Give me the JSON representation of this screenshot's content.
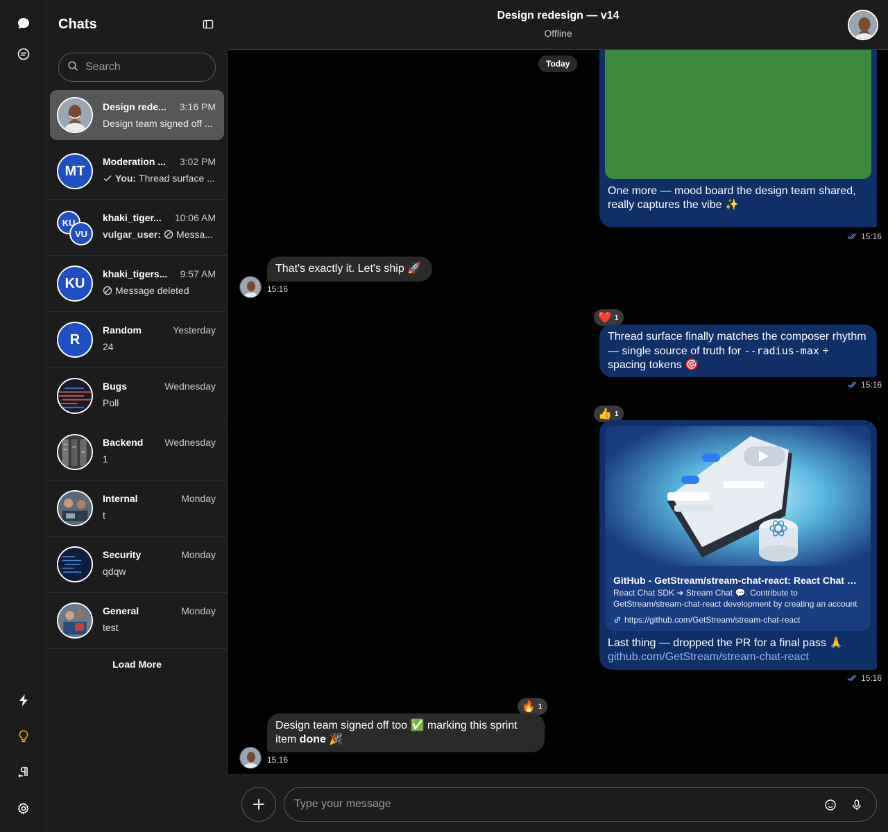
{
  "app": {
    "accent_color": "#0f2f66",
    "link_color": "#8fb4ff"
  },
  "rail": {
    "top_icons": [
      "chat-bubble-icon",
      "threads-icon"
    ],
    "bottom_icons": [
      "bolt-icon",
      "lightbulb-icon",
      "text-direction-icon",
      "gear-icon"
    ],
    "highlight_color": "#f0b400"
  },
  "channel_list": {
    "title": "Chats",
    "search_placeholder": "Search",
    "load_more": "Load More",
    "channels": [
      {
        "name": "Design rede...",
        "time": "3:16 PM",
        "preview": "Design team signed off ...",
        "avatar_type": "photo",
        "active": true
      },
      {
        "name": "Moderation ...",
        "time": "3:02 PM",
        "preview_prefix": "You:",
        "preview": "Thread surface ...",
        "avatar_initials": "MT",
        "status_icon": "check-icon"
      },
      {
        "name": "khaki_tiger...",
        "time": "10:06 AM",
        "preview_prefix": "vulgar_user:",
        "preview": "Messa...",
        "avatar_initials": "KU",
        "avatar_initials_2": "VU",
        "status_icon": "deleted-icon"
      },
      {
        "name": "khaki_tigers...",
        "time": "9:57 AM",
        "preview": "Message deleted",
        "avatar_initials": "KU",
        "status_icon": "deleted-icon"
      },
      {
        "name": "Random",
        "time": "Yesterday",
        "preview": "24",
        "avatar_initials": "R"
      },
      {
        "name": "Bugs",
        "time": "Wednesday",
        "preview": "Poll",
        "avatar_type": "photo"
      },
      {
        "name": "Backend",
        "time": "Wednesday",
        "preview": "1",
        "avatar_type": "photo"
      },
      {
        "name": "Internal",
        "time": "Monday",
        "preview": "t",
        "avatar_type": "photo"
      },
      {
        "name": "Security",
        "time": "Monday",
        "preview": "qdqw",
        "avatar_type": "photo"
      },
      {
        "name": "General",
        "time": "Monday",
        "preview": "test",
        "avatar_type": "photo"
      }
    ]
  },
  "header": {
    "title": "Design redesign — v14",
    "subtitle": "Offline"
  },
  "messages": {
    "date_separator": "Today",
    "items": [
      {
        "direction": "out",
        "text": "One more — mood board the design team shared, really captures the vibe ✨",
        "time": "15:16",
        "attachment_color": "#3d8a3f"
      },
      {
        "direction": "in",
        "text": "That's exactly it. Let's ship 🚀",
        "time": "15:16"
      },
      {
        "direction": "out",
        "text_1": "Thread surface finally matches the composer rhythm — single source of truth for ",
        "code": "--radius-max",
        "text_2": " + spacing tokens 🎯",
        "time": "15:16",
        "reaction": {
          "emoji": "❤️",
          "count": "1"
        }
      },
      {
        "direction": "out",
        "text": "Last thing — dropped the PR for a final pass 🙏",
        "link": "github.com/GetStream/stream-chat-react",
        "time": "15:16",
        "reaction": {
          "emoji": "👍",
          "count": "1"
        },
        "link_preview": {
          "title": "GitHub - GetStream/stream-chat-react: React Chat SDK ➜ Stream Chat 💬",
          "description": "React Chat SDK ➜ Stream Chat 💬. Contribute to GetStream/stream-chat-react development by creating an account on GitHub.",
          "url": "https://github.com/GetStream/stream-chat-react"
        }
      },
      {
        "direction": "in",
        "text_1": "Design team signed off too ✅ marking this sprint item ",
        "bold": "done",
        "text_2": " 🎉",
        "time": "15:16",
        "reaction": {
          "emoji": "🔥",
          "count": "1"
        }
      }
    ]
  },
  "composer": {
    "placeholder": "Type your message"
  }
}
